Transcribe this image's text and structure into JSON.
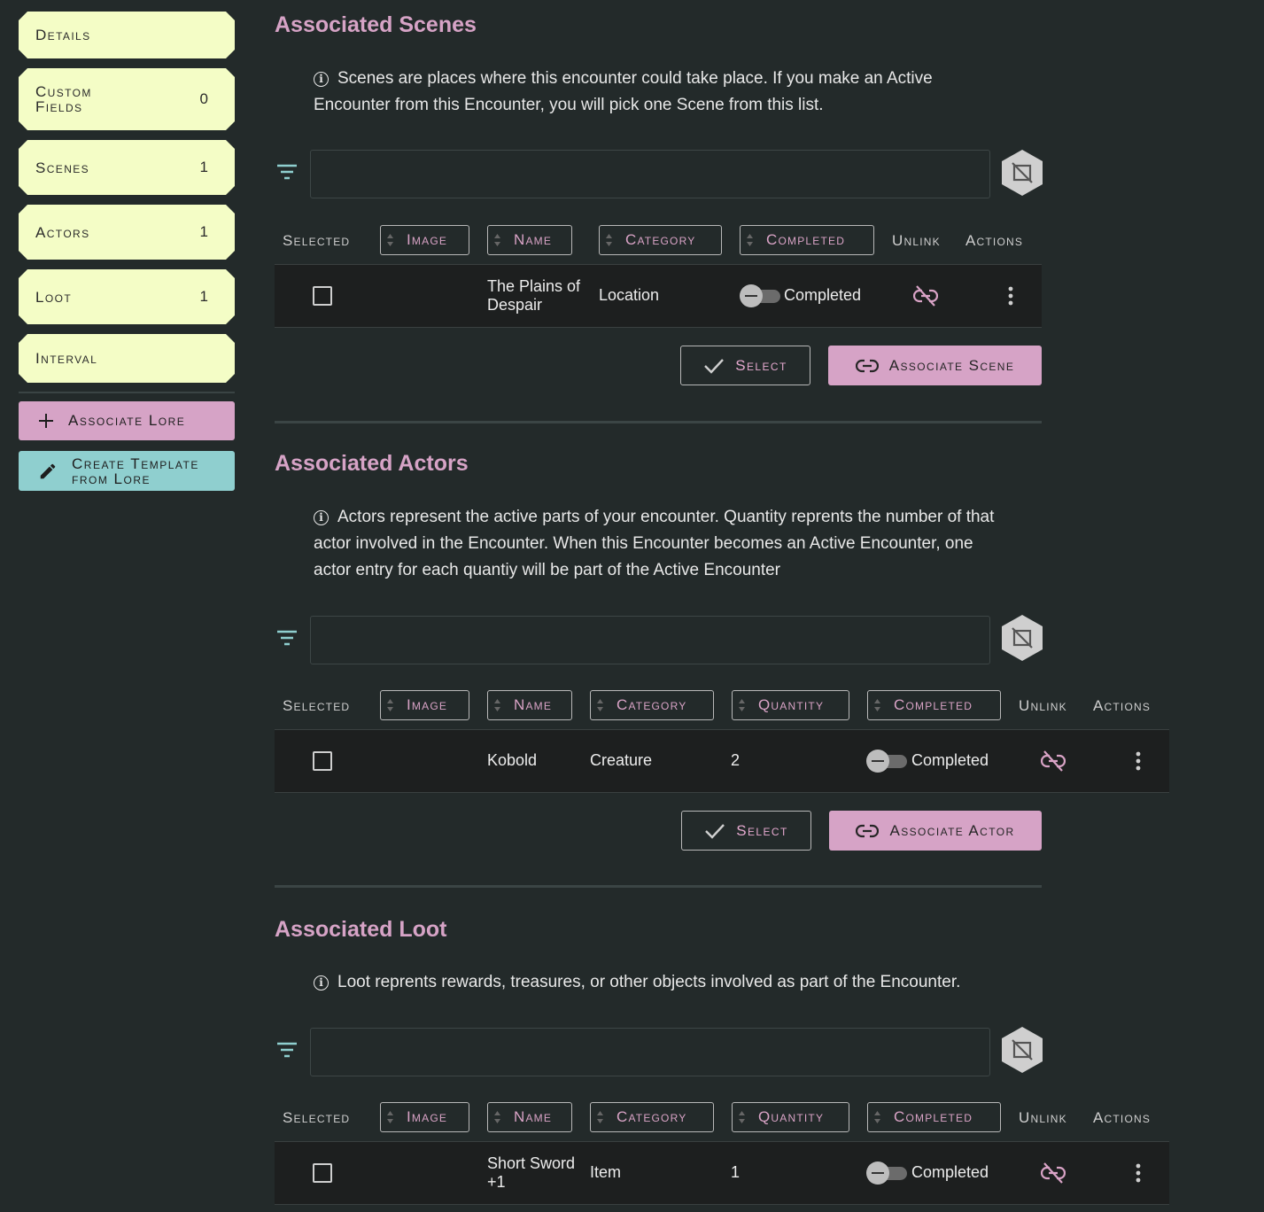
{
  "colors": {
    "background": "#232a2a",
    "nav_bg": "#f4fdc6",
    "accent_pink": "#d6a3c6",
    "accent_teal": "#8fcfcf"
  },
  "sidebar": {
    "items": [
      {
        "label": "Details",
        "count": ""
      },
      {
        "label": "Custom Fields",
        "count": "0"
      },
      {
        "label": "Scenes",
        "count": "1"
      },
      {
        "label": "Actors",
        "count": "1"
      },
      {
        "label": "Loot",
        "count": "1"
      },
      {
        "label": "Interval",
        "count": ""
      }
    ],
    "associate_lore": "Associate Lore",
    "create_template": "Create Template from Lore"
  },
  "scenes": {
    "title": "Associated Scenes",
    "info": "Scenes are places where this encounter could take place. If you make an Active Encounter from this Encounter, you will pick one Scene from this list.",
    "headers": {
      "selected": "Selected",
      "image": "Image",
      "name": "Name",
      "category": "Category",
      "completed": "Completed",
      "unlink": "Unlink",
      "actions": "Actions"
    },
    "rows": [
      {
        "name": "The Plains of Despair",
        "category": "Location",
        "completed": "Completed"
      }
    ],
    "select_button": "Select",
    "associate_button": "Associate Scene"
  },
  "actors": {
    "title": "Associated Actors",
    "info": "Actors represent the active parts of your encounter. Quantity reprents the number of that actor involved in the Encounter. When this Encounter becomes an Active Encounter, one actor entry for each quantiy will be part of the Active Encounter",
    "headers": {
      "selected": "Selected",
      "image": "Image",
      "name": "Name",
      "category": "Category",
      "quantity": "Quantity",
      "completed": "Completed",
      "unlink": "Unlink",
      "actions": "Actions"
    },
    "rows": [
      {
        "name": "Kobold",
        "category": "Creature",
        "quantity": "2",
        "completed": "Completed"
      }
    ],
    "select_button": "Select",
    "associate_button": "Associate Actor"
  },
  "loot": {
    "title": "Associated Loot",
    "info": "Loot reprents rewards, treasures, or other objects involved as part of the Encounter.",
    "headers": {
      "selected": "Selected",
      "image": "Image",
      "name": "Name",
      "category": "Category",
      "quantity": "Quantity",
      "completed": "Completed",
      "unlink": "Unlink",
      "actions": "Actions"
    },
    "rows": [
      {
        "name": "Short Sword +1",
        "category": "Item",
        "quantity": "1",
        "completed": "Completed"
      }
    ]
  }
}
